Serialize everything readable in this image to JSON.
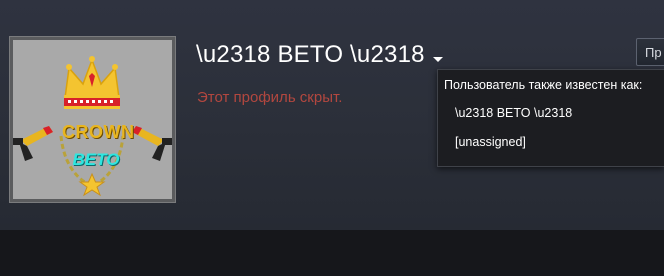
{
  "profile": {
    "name": "\\u2318 BETO \\u2318",
    "private_text": "Этот профиль скрыт.",
    "avatar_text": {
      "top": "CROWN",
      "bottom": "BETO"
    }
  },
  "top_button": {
    "label": "Пр"
  },
  "alias_popup": {
    "title": "Пользователь также известен как:",
    "aliases": [
      "\\u2318 BETO \\u2318",
      "[unassigned]"
    ]
  },
  "colors": {
    "private_text": "#b2473f",
    "crown_gold": "#f4c430",
    "crown_text": "#e8b51f",
    "beto_text": "#2ee6e0",
    "page_bg": "#2b2f39",
    "popup_bg": "#1c1d21"
  },
  "icons": {
    "name_dropdown": "caret-down-icon",
    "avatar": "crown-logo",
    "guns": "pistol-icon"
  }
}
